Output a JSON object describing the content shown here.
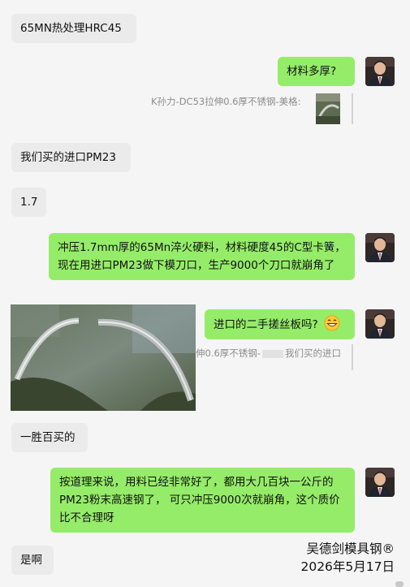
{
  "colors": {
    "background": "#f5f5f5",
    "left_bubble": "#ebebeb",
    "right_bubble": "#95ec69",
    "quote_text": "#8c8c8c"
  },
  "messages": {
    "m1": "65MN热处理HRC45",
    "m2": "材料多厚?",
    "m2_quote": "K孙力-DC53拉伸0.6厚不锈钢-美格:",
    "m3": "我们买的进口PM23",
    "m4": "1.7",
    "m5": "冲压1.7mm厚的65Mn淬火硬料，材料硬度45的C型卡簧，现在用进口PM23做下模刀口，生产9000个刀口就崩角了",
    "m6": "进口的二手搓丝板吗?",
    "m6_emoji": "😁",
    "m6_quote_a": "伸0.6厚不锈钢-",
    "m6_quote_b": "我们买的进口",
    "m7": "一胜百买的",
    "m8": "按道理来说，用料已经非常好了，都用大几百块一公斤的PM23粉末高速钢了，  可只冲压9000次就崩角，这个质价比不合理呀",
    "m9": "是啊"
  },
  "watermark": {
    "line1": "吴德剑模具钢®",
    "line2": "2026年5月17日"
  },
  "icons": {
    "avatar": "user-avatar-icon",
    "emoji": "grinning-face-icon"
  }
}
